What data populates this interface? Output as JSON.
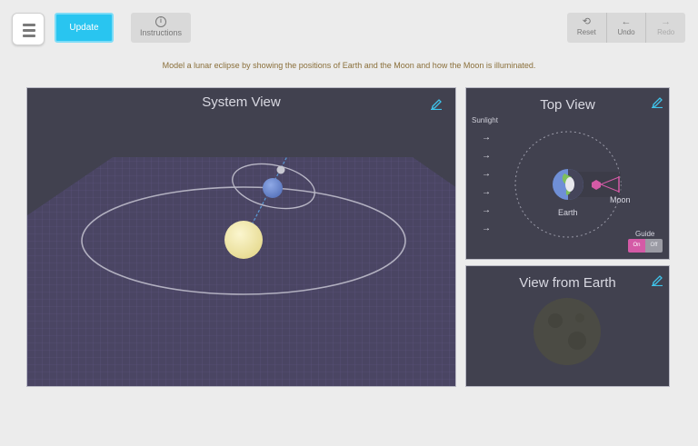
{
  "toolbar": {
    "update_label": "Update",
    "instructions_label": "Instructions",
    "instructions_icon": "info-icon",
    "reset_label": "Reset",
    "undo_label": "Undo",
    "redo_label": "Redo"
  },
  "prompt": "Model a lunar eclipse by showing the positions of Earth and the Moon and how the Moon is illuminated.",
  "system_view": {
    "title": "System View"
  },
  "top_view": {
    "title": "Top View",
    "sunlight_label": "Sunlight",
    "earth_label": "Earth",
    "moon_label": "Moon",
    "guide_label": "Guide",
    "guide_on": "On",
    "guide_off": "Off",
    "guide_state": "On"
  },
  "earth_view": {
    "title": "View from Earth"
  },
  "colors": {
    "accent": "#29c5f0",
    "panel_bg": "#41414f",
    "guide_on": "#d45aa6",
    "sun": "#f3eab0",
    "earth": "#6f8fd6"
  }
}
